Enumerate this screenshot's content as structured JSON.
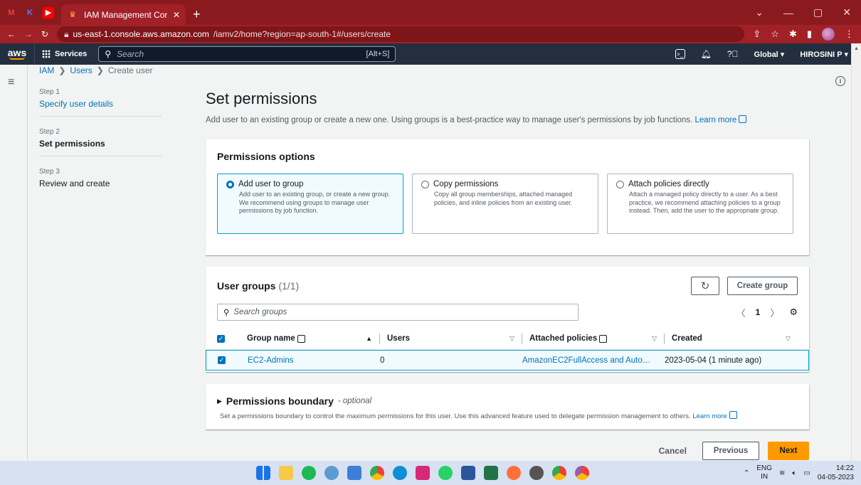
{
  "browser": {
    "tab_title": "IAM Management Console",
    "url_host": "us-east-1.console.aws.amazon.com",
    "url_path": "/iamv2/home?region=ap-south-1#/users/create"
  },
  "aws_header": {
    "logo": "aws",
    "services": "Services",
    "search_placeholder": "Search",
    "search_shortcut": "[Alt+S]",
    "region": "Global ▾",
    "account": "HIROSINI P ▾"
  },
  "breadcrumb": [
    "IAM",
    "Users",
    "Create user"
  ],
  "steps": [
    {
      "num": "Step 1",
      "label": "Specify user details",
      "state": "done"
    },
    {
      "num": "Step 2",
      "label": "Set permissions",
      "state": "active"
    },
    {
      "num": "Step 3",
      "label": "Review and create",
      "state": "todo"
    }
  ],
  "page": {
    "title": "Set permissions",
    "description": "Add user to an existing group or create a new one. Using groups is a best-practice way to manage user's permissions by job functions.",
    "learn_more": "Learn more"
  },
  "permissions_options": {
    "heading": "Permissions options",
    "options": [
      {
        "title": "Add user to group",
        "desc": "Add user to an existing group, or create a new group. We recommend using groups to manage user permissions by job function.",
        "selected": true
      },
      {
        "title": "Copy permissions",
        "desc": "Copy all group memberships, attached managed policies, and inline policies from an existing user.",
        "selected": false
      },
      {
        "title": "Attach policies directly",
        "desc": "Attach a managed policy directly to a user. As a best practice, we recommend attaching policies to a group instead. Then, add the user to the appropriate group.",
        "selected": false
      }
    ]
  },
  "user_groups": {
    "title": "User groups",
    "count": "(1/1)",
    "create_group": "Create group",
    "search_placeholder": "Search groups",
    "page": "1",
    "columns": [
      "Group name",
      "Users",
      "Attached policies",
      "Created"
    ],
    "rows": [
      {
        "name": "EC2-Admins",
        "users": "0",
        "policies": "AmazonEC2FullAccess and Auto…",
        "created": "2023-05-04 (1 minute ago)"
      }
    ]
  },
  "boundary": {
    "title": "Permissions boundary",
    "optional": "- optional",
    "desc": "Set a permissions boundary to control the maximum permissions for this user. Use this advanced feature used to delegate permission management to others.",
    "learn_more": "Learn more"
  },
  "footer": {
    "cancel": "Cancel",
    "previous": "Previous",
    "next": "Next"
  },
  "taskbar": {
    "lang_top": "ENG",
    "lang_bottom": "IN",
    "time": "14:22",
    "date": "04-05-2023"
  }
}
